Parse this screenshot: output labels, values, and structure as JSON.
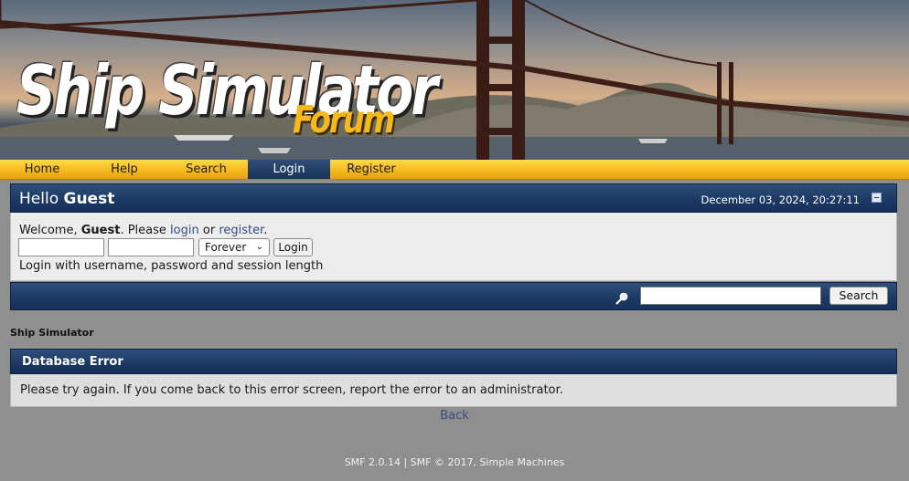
{
  "banner": {
    "title": "Ship Simulator",
    "subtitle": "Forum"
  },
  "menu": {
    "items": [
      {
        "label": "Home"
      },
      {
        "label": "Help"
      },
      {
        "label": "Search"
      },
      {
        "label": "Login"
      },
      {
        "label": "Register"
      }
    ],
    "active": "Login"
  },
  "user_section": {
    "hello_prefix": "Hello",
    "hello_name": "Guest",
    "date": "December 03, 2024, 20:27:11",
    "collapse_icon": "minus-box-icon"
  },
  "login": {
    "welcome_prefix": "Welcome,",
    "welcome_name": "Guest",
    "welcome_mid": ". Please",
    "login_link": "login",
    "or": "or",
    "register_link": "register",
    "end": ".",
    "username_value": "",
    "password_value": "",
    "session_length": "Forever",
    "submit_label": "Login",
    "hint": "Login with username, password and session length"
  },
  "search": {
    "icon": "search-magnifier-icon",
    "value": "",
    "button_label": "Search"
  },
  "breadcrumb": "Ship Simulator",
  "error": {
    "title": "Database Error",
    "message": "Please try again. If you come back to this error screen, report the error to an administrator.",
    "back_link": "Back"
  },
  "footer": "SMF 2.0.14 | SMF © 2017, Simple Machines",
  "colors": {
    "accent_blue": "#1c3a64",
    "menu_yellow": "#f4b71b",
    "background": "#8f8f8f"
  }
}
